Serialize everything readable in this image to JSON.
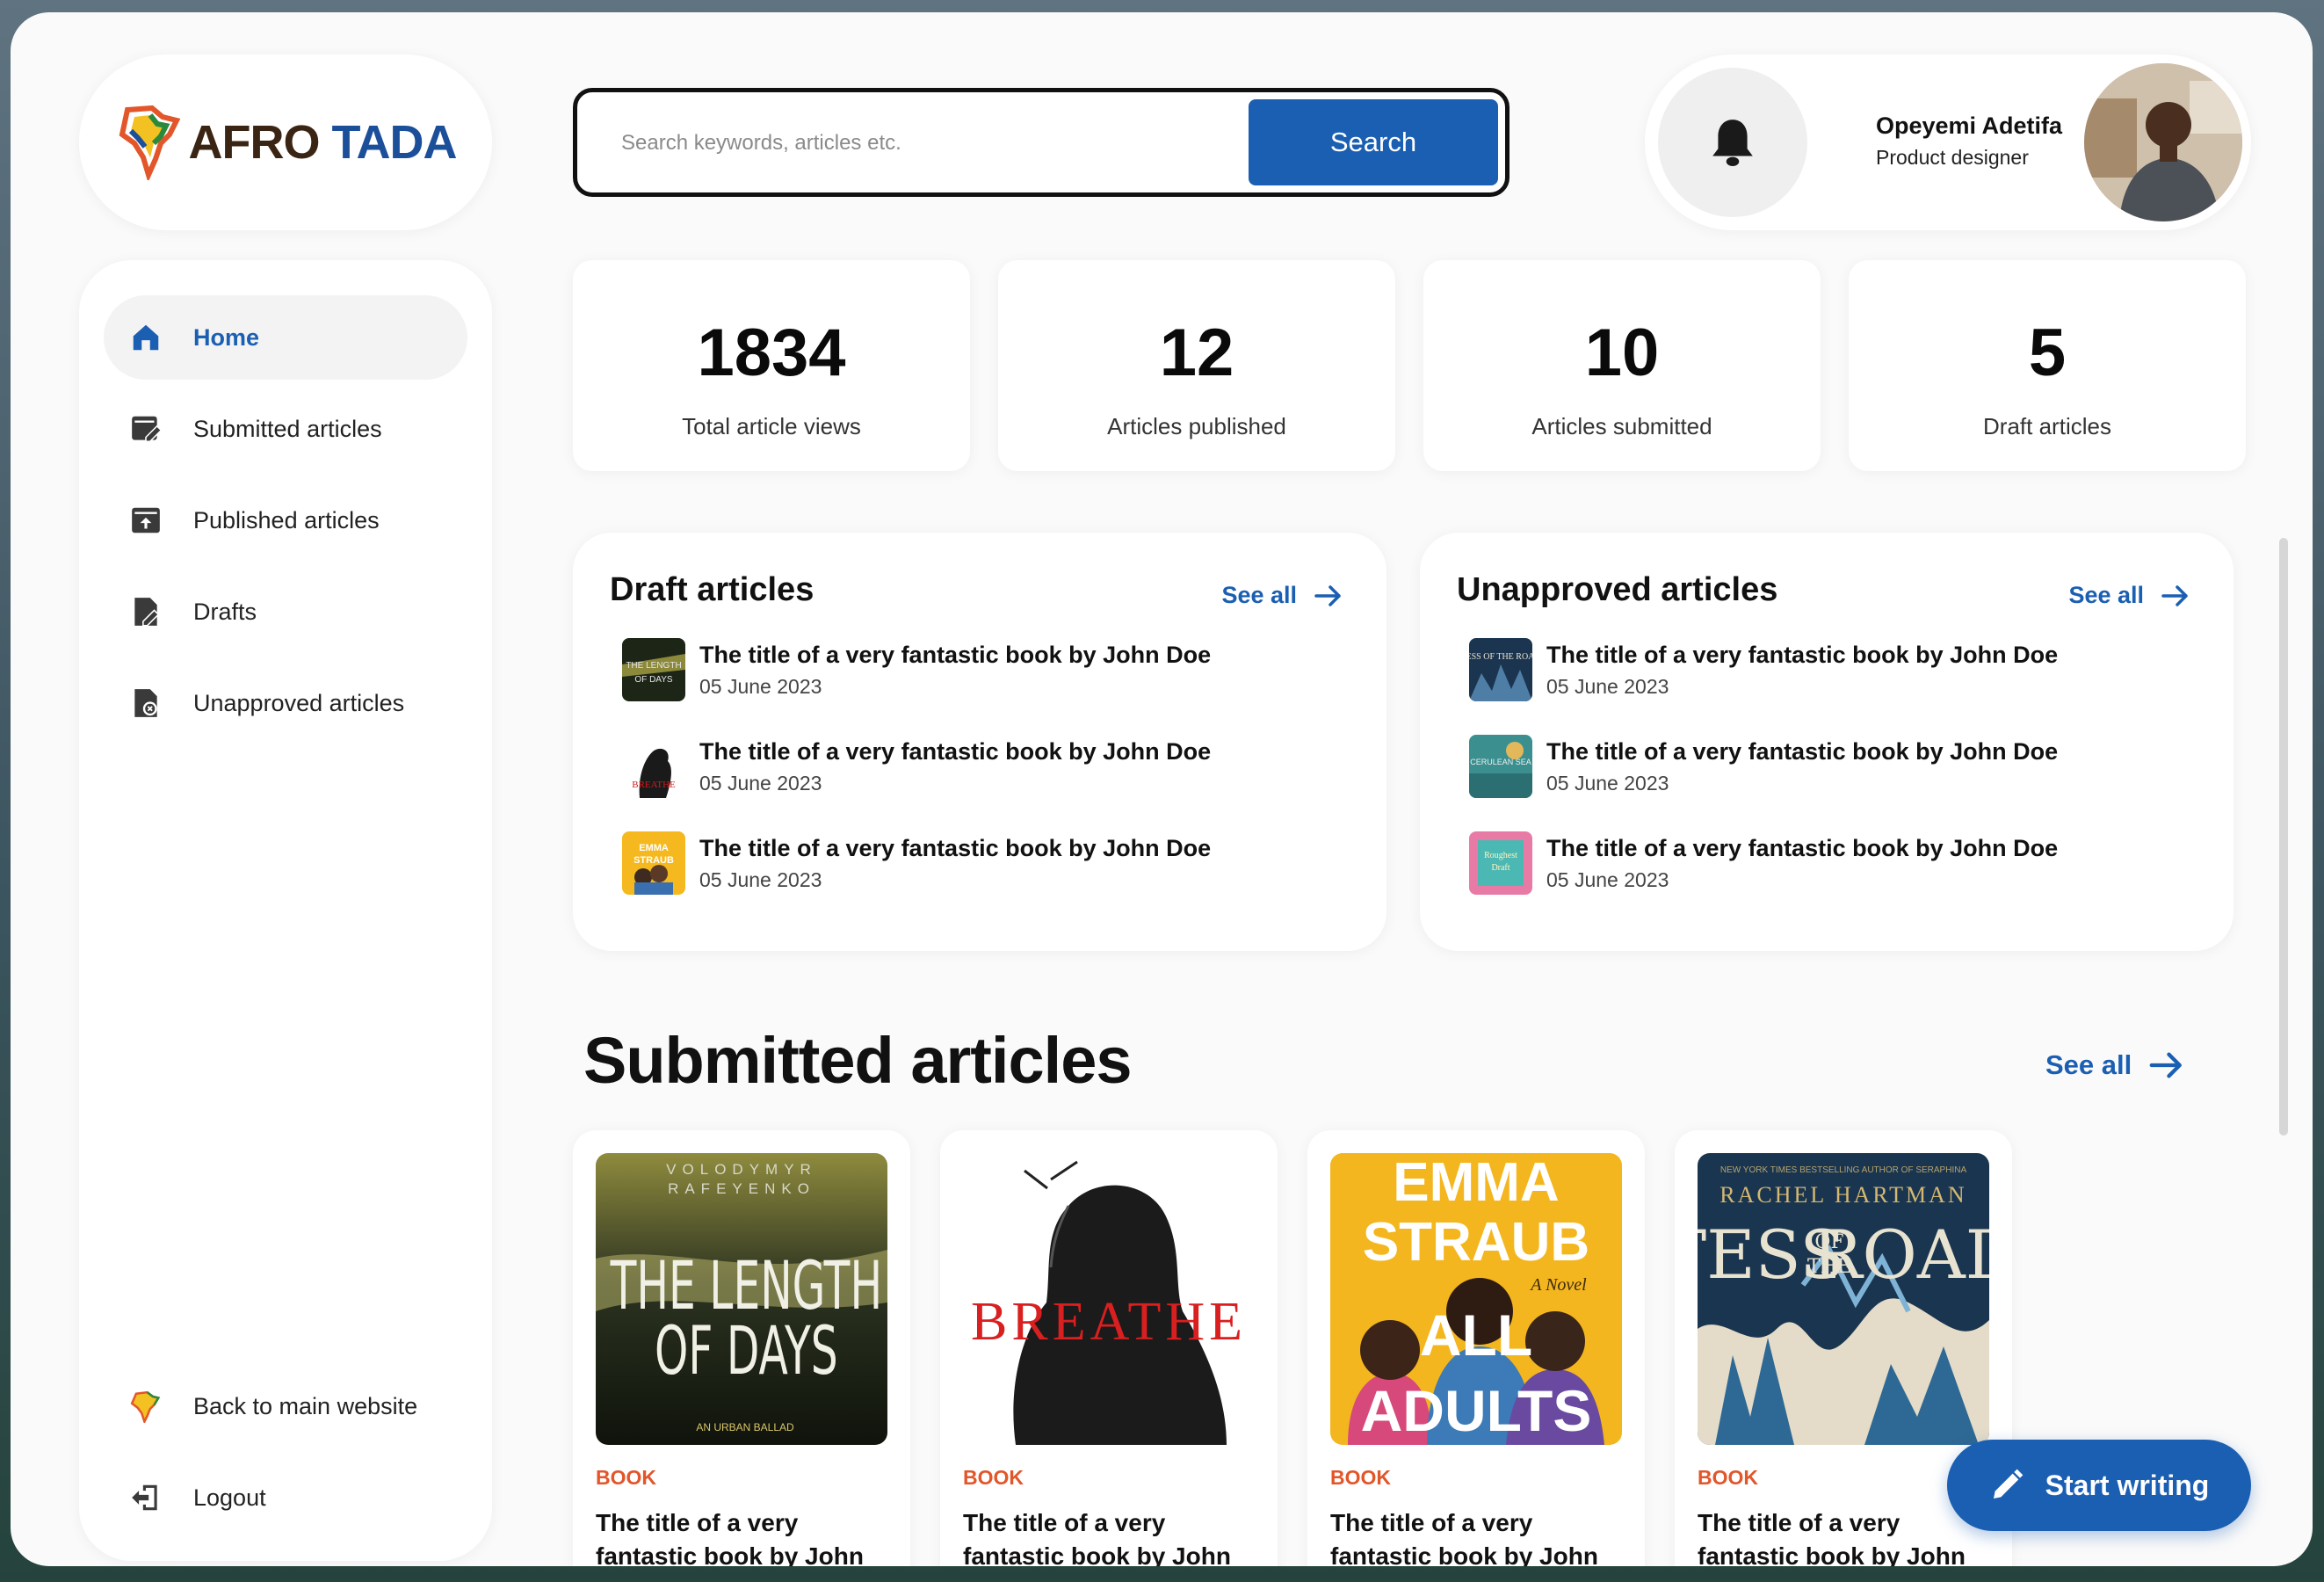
{
  "brand": {
    "name_part1": "AFRO",
    "name_part2": "TADA"
  },
  "search": {
    "placeholder": "Search keywords, articles etc.",
    "button_label": "Search"
  },
  "user": {
    "name": "Opeyemi Adetifa",
    "role": "Product designer"
  },
  "sidebar": {
    "items": [
      {
        "label": "Home",
        "icon": "home-icon",
        "active": true
      },
      {
        "label": "Submitted articles",
        "icon": "submitted-icon"
      },
      {
        "label": "Published articles",
        "icon": "published-icon"
      },
      {
        "label": "Drafts",
        "icon": "drafts-icon"
      },
      {
        "label": "Unapproved articles",
        "icon": "unapproved-icon"
      }
    ],
    "footer": [
      {
        "label": "Back to main website",
        "icon": "afro-tada-logo-icon"
      },
      {
        "label": "Logout",
        "icon": "logout-icon"
      }
    ]
  },
  "stats": [
    {
      "value": "1834",
      "label": "Total article views"
    },
    {
      "value": "12",
      "label": "Articles published"
    },
    {
      "value": "10",
      "label": "Articles submitted"
    },
    {
      "value": "5",
      "label": "Draft articles"
    }
  ],
  "draft_panel": {
    "title": "Draft articles",
    "see_all": "See all",
    "items": [
      {
        "title": "The title of  a very fantastic book by John Doe",
        "date": "05 June 2023",
        "cover_text": "THE LENGTH OF DAYS"
      },
      {
        "title": "The title of  a very fantastic book by John Doe",
        "date": "05 June 2023",
        "cover_text": "BREATHE"
      },
      {
        "title": "The title of  a very fantastic book by John Doe",
        "date": "05 June 2023",
        "cover_text": "EMMA STRAUB ALL"
      }
    ]
  },
  "unapproved_panel": {
    "title": "Unapproved articles",
    "see_all": "See all",
    "items": [
      {
        "title": "The title of  a very fantastic book by John Doe",
        "date": "05 June 2023",
        "cover_text": "TESS OF THE ROAD"
      },
      {
        "title": "The title of  a very fantastic book by John Doe",
        "date": "05 June 2023",
        "cover_text": "THE HOUSE IN THE CERULEAN SEA"
      },
      {
        "title": "The title of  a very fantastic book by John Doe",
        "date": "05 June 2023",
        "cover_text": "The Roughest Draft"
      }
    ]
  },
  "submitted": {
    "title": "Submitted articles",
    "see_all": "See all",
    "books": [
      {
        "tag": "BOOK",
        "title": "The title of  a very fantastic book by John",
        "cover": {
          "author": "VOLODYMYR RAFEYENKO",
          "line1": "THE LENGTH",
          "line2": "OF DAYS",
          "sub": "AN URBAN BALLAD"
        }
      },
      {
        "tag": "BOOK",
        "title": "The title of  a very fantastic book by John",
        "cover": {
          "line1": "BREATHE"
        }
      },
      {
        "tag": "BOOK",
        "title": "The title of  a very fantastic book by John",
        "cover": {
          "line1": "EMMA",
          "line2": "STRAUB",
          "line3": "ALL",
          "line4": "ADULTS",
          "sub": "A Novel"
        }
      },
      {
        "tag": "BOOK",
        "title": "The title of  a very fantastic book by John",
        "cover": {
          "tagline": "NEW YORK TIMES BESTSELLING AUTHOR OF SERAPHINA",
          "author": "RACHEL HARTMAN",
          "line1": "TESS",
          "line2": "OF THE",
          "line3": "ROAD"
        }
      }
    ]
  },
  "fab": {
    "label": "Start writing"
  },
  "colors": {
    "accent": "#1b5fb3",
    "tag": "#e2562a",
    "background": "#fafafa"
  }
}
